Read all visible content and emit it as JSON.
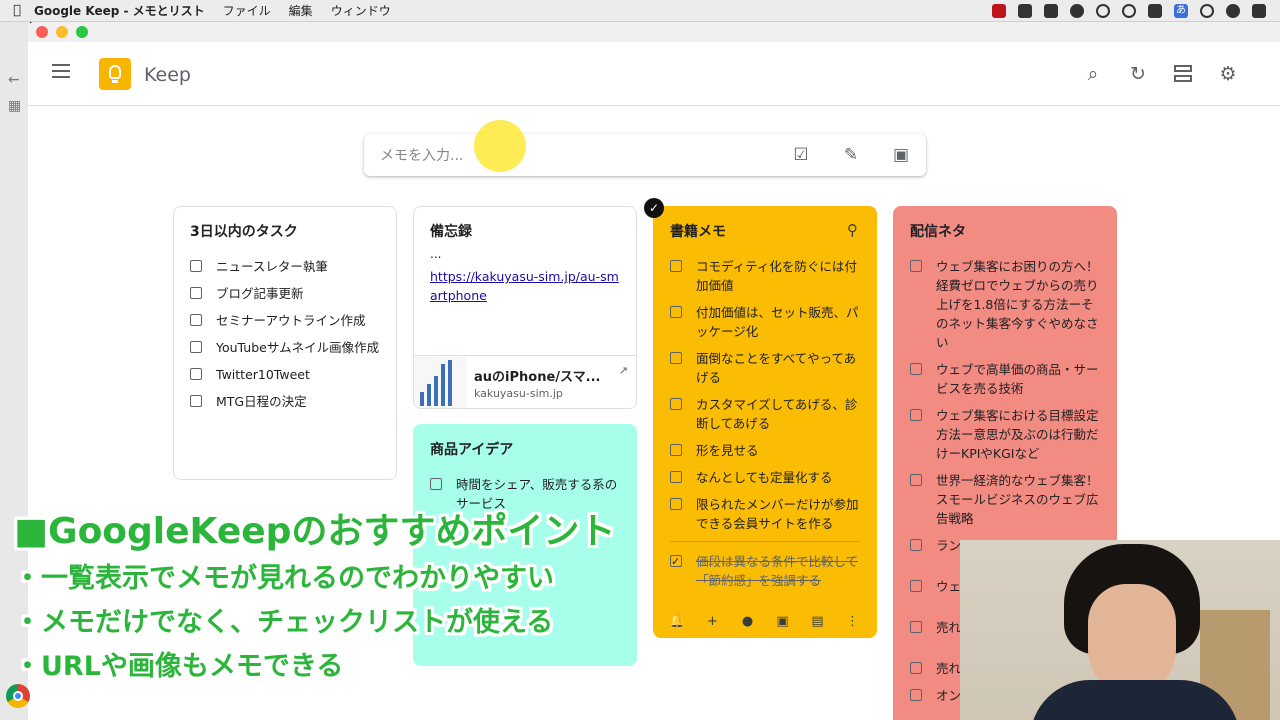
{
  "menubar": {
    "app": "Google Keep - メモとリスト",
    "items": [
      "ファイル",
      "編集",
      "ウィンドウ"
    ],
    "tray_input": "あ"
  },
  "header": {
    "title": "Keep"
  },
  "takenote": {
    "placeholder": "メモを入力..."
  },
  "notes": {
    "tasks": {
      "title": "3日以内のタスク",
      "items": [
        "ニュースレター執筆",
        "ブログ記事更新",
        "セミナーアウトライン作成",
        "YouTubeサムネイル画像作成",
        "Twitter10Tweet",
        "MTG日程の決定"
      ]
    },
    "memo": {
      "title": "備忘録",
      "body": "...",
      "link": "https://kakuyasu-sim.jp/au-smartphone",
      "preview_title": "auのiPhone/スマ...",
      "preview_host": "kakuyasu-sim.jp"
    },
    "products": {
      "title": "商品アイデア",
      "items": [
        "時間をシェア、販売する系のサービス"
      ]
    },
    "books": {
      "title": "書籍メモ",
      "items": [
        "コモディティ化を防ぐには付加価値",
        "付加価値は、セット販売、パッケージ化",
        "面倒なことをすべてやってあげる",
        "カスタマイズしてあげる、診断してあげる",
        "形を見せる",
        "なんとしても定量化する",
        "限られたメンバーだけが参加できる会員サイトを作る"
      ],
      "checked_items": [
        "価段は異なる条件で比較して「節約感」を強調する"
      ]
    },
    "topics": {
      "title": "配信ネタ",
      "items": [
        "ウェブ集客にお困りの方へ！経費ゼロでウェブからの売り上げを1.8倍にする方法ーそのネット集客今すぐやめなさい",
        "ウェブで高単価の商品・サービスを売る技術",
        "ウェブ集客における目標設定方法ー意思が及ぶのは行動だけーKPIやKGIなど",
        "世界一経済的なウェブ集客！スモールビジネスのウェブ広告戦略",
        "ラン",
        "ウェ",
        "売れ",
        "売れ",
        "オン"
      ]
    }
  },
  "caption": {
    "title": "■GoogleKeepのおすすめポイント",
    "bullets": [
      "・一覧表示でメモが見れるのでわかりやすい",
      "・メモだけでなく、チェックリストが使える",
      "・URLや画像もメモできる"
    ]
  },
  "colors": {
    "yellow_note": "#fbbc04",
    "red_note": "#f28b82",
    "teal_note": "#a7ffeb",
    "caption_green": "#2cb53b"
  }
}
